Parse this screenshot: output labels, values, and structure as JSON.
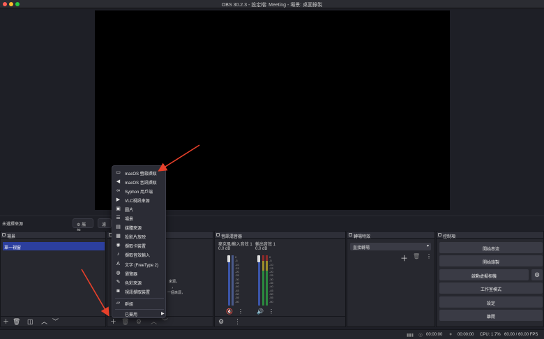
{
  "window": {
    "title": "OBS 30.2.3 - 設定檔: Meeting - 場景: 桌面錄製"
  },
  "props_bar": {
    "no_source": "未選擇來源",
    "properties_label": "屬性",
    "filters_label": "濾"
  },
  "scenes": {
    "title": "場景",
    "items": [
      "單一視窗"
    ]
  },
  "sources": {
    "title": "",
    "partial_lines": [
      "來源，",
      "，",
      "一個來源，"
    ]
  },
  "mixer": {
    "title": "音訊混音器",
    "channels": [
      {
        "name": "麥克風/輸入音效 1",
        "db": "0.0 dB"
      },
      {
        "name": "輸出音效 1",
        "db": "0.0 dB"
      }
    ],
    "scale": [
      "0",
      "-5",
      "-10",
      "-15",
      "-20",
      "-25",
      "-30",
      "-35",
      "-40",
      "-45",
      "-50",
      "-55",
      "-60"
    ]
  },
  "transitions": {
    "title": "轉場特效",
    "selected": "直接轉場"
  },
  "controls": {
    "title": "控制項",
    "buttons": [
      "開始串流",
      "開始錄製",
      "啟動虛擬相機",
      "工作室模式",
      "設定",
      "離開"
    ]
  },
  "context_menu": {
    "items": [
      {
        "label": "macOS 螢幕擷取",
        "icon": "monitor-icon"
      },
      {
        "label": "macOS 音訊擷取",
        "icon": "speaker-icon"
      },
      {
        "label": "Syphon 用戶端",
        "icon": "link-icon"
      },
      {
        "label": "VLC視訊來源",
        "icon": "play-icon"
      },
      {
        "label": "圖片",
        "icon": "image-icon"
      },
      {
        "label": "場景",
        "icon": "list-icon"
      },
      {
        "label": "媒體來源",
        "icon": "media-icon"
      },
      {
        "label": "投影片放映",
        "icon": "slideshow-icon"
      },
      {
        "label": "擷取卡裝置",
        "icon": "camera-icon"
      },
      {
        "label": "擷取音效輸入",
        "icon": "microphone-icon"
      },
      {
        "label": "文字 (FreeType 2)",
        "icon": "text-icon"
      },
      {
        "label": "瀏覽器",
        "icon": "globe-icon"
      },
      {
        "label": "色彩來源",
        "icon": "brush-icon"
      },
      {
        "label": "視訊擷取裝置",
        "icon": "webcam-icon"
      },
      {
        "label": "群組",
        "icon": "folder-icon"
      },
      {
        "label": "已棄用",
        "icon": ""
      }
    ]
  },
  "status": {
    "time1": "00:00:00",
    "time2": "00:00:00",
    "cpu": "CPU: 1.7%",
    "fps": "60.00 / 60.00 FPS"
  },
  "colors": {
    "accent": "#2c3f9e",
    "arrow": "#e8402a"
  }
}
